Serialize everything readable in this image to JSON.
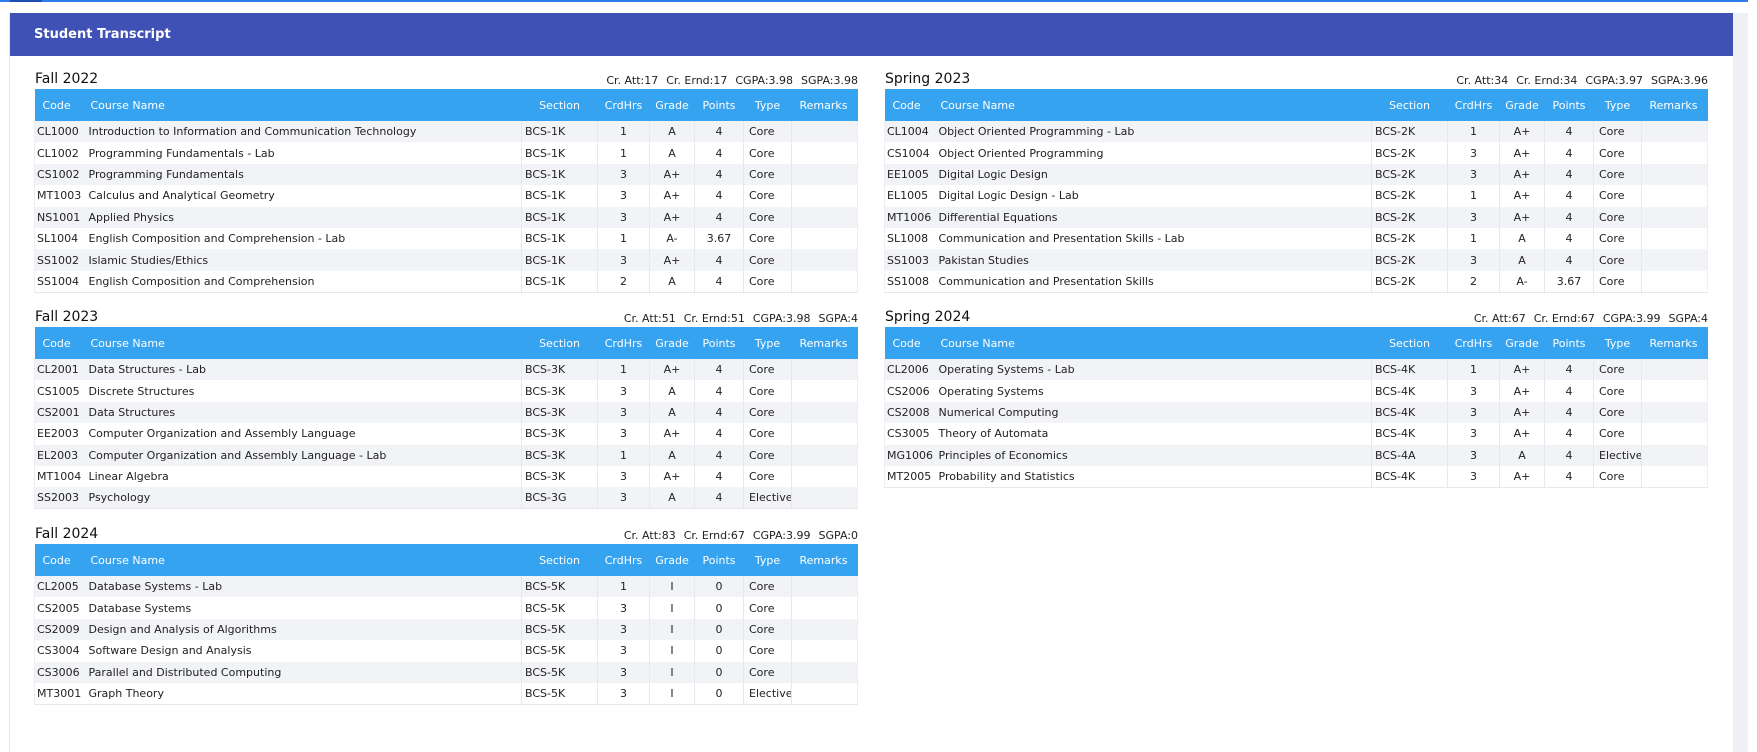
{
  "page": {
    "title": "Student Transcript"
  },
  "columns": [
    "Code",
    "Course Name",
    "Section",
    "CrdHrs",
    "Grade",
    "Points",
    "Type",
    "Remarks"
  ],
  "semesters": [
    {
      "name": "Fall 2022",
      "stats": {
        "cr_att": "Cr. Att:17",
        "cr_ernd": "Cr. Ernd:17",
        "cgpa": "CGPA:3.98",
        "sgpa": "SGPA:3.98"
      },
      "rows": [
        [
          "CL1000",
          "Introduction to Information and Communication Technology",
          "BCS-1K",
          "1",
          "A",
          "4",
          "Core",
          ""
        ],
        [
          "CL1002",
          "Programming Fundamentals - Lab",
          "BCS-1K",
          "1",
          "A",
          "4",
          "Core",
          ""
        ],
        [
          "CS1002",
          "Programming Fundamentals",
          "BCS-1K",
          "3",
          "A+",
          "4",
          "Core",
          ""
        ],
        [
          "MT1003",
          "Calculus and Analytical Geometry",
          "BCS-1K",
          "3",
          "A+",
          "4",
          "Core",
          ""
        ],
        [
          "NS1001",
          "Applied Physics",
          "BCS-1K",
          "3",
          "A+",
          "4",
          "Core",
          ""
        ],
        [
          "SL1004",
          "English Composition and Comprehension - Lab",
          "BCS-1K",
          "1",
          "A-",
          "3.67",
          "Core",
          ""
        ],
        [
          "SS1002",
          "Islamic Studies/Ethics",
          "BCS-1K",
          "3",
          "A+",
          "4",
          "Core",
          ""
        ],
        [
          "SS1004",
          "English Composition and Comprehension",
          "BCS-1K",
          "2",
          "A",
          "4",
          "Core",
          ""
        ]
      ]
    },
    {
      "name": "Spring 2023",
      "stats": {
        "cr_att": "Cr. Att:34",
        "cr_ernd": "Cr. Ernd:34",
        "cgpa": "CGPA:3.97",
        "sgpa": "SGPA:3.96"
      },
      "rows": [
        [
          "CL1004",
          "Object Oriented Programming - Lab",
          "BCS-2K",
          "1",
          "A+",
          "4",
          "Core",
          ""
        ],
        [
          "CS1004",
          "Object Oriented Programming",
          "BCS-2K",
          "3",
          "A+",
          "4",
          "Core",
          ""
        ],
        [
          "EE1005",
          "Digital Logic Design",
          "BCS-2K",
          "3",
          "A+",
          "4",
          "Core",
          ""
        ],
        [
          "EL1005",
          "Digital Logic Design - Lab",
          "BCS-2K",
          "1",
          "A+",
          "4",
          "Core",
          ""
        ],
        [
          "MT1006",
          "Differential Equations",
          "BCS-2K",
          "3",
          "A+",
          "4",
          "Core",
          ""
        ],
        [
          "SL1008",
          "Communication and Presentation Skills - Lab",
          "BCS-2K",
          "1",
          "A",
          "4",
          "Core",
          ""
        ],
        [
          "SS1003",
          "Pakistan Studies",
          "BCS-2K",
          "3",
          "A",
          "4",
          "Core",
          ""
        ],
        [
          "SS1008",
          "Communication and Presentation Skills",
          "BCS-2K",
          "2",
          "A-",
          "3.67",
          "Core",
          ""
        ]
      ]
    },
    {
      "name": "Fall 2023",
      "stats": {
        "cr_att": "Cr. Att:51",
        "cr_ernd": "Cr. Ernd:51",
        "cgpa": "CGPA:3.98",
        "sgpa": "SGPA:4"
      },
      "rows": [
        [
          "CL2001",
          "Data Structures - Lab",
          "BCS-3K",
          "1",
          "A+",
          "4",
          "Core",
          ""
        ],
        [
          "CS1005",
          "Discrete Structures",
          "BCS-3K",
          "3",
          "A",
          "4",
          "Core",
          ""
        ],
        [
          "CS2001",
          "Data Structures",
          "BCS-3K",
          "3",
          "A",
          "4",
          "Core",
          ""
        ],
        [
          "EE2003",
          "Computer Organization and Assembly Language",
          "BCS-3K",
          "3",
          "A+",
          "4",
          "Core",
          ""
        ],
        [
          "EL2003",
          "Computer Organization and Assembly Language - Lab",
          "BCS-3K",
          "1",
          "A",
          "4",
          "Core",
          ""
        ],
        [
          "MT1004",
          "Linear Algebra",
          "BCS-3K",
          "3",
          "A+",
          "4",
          "Core",
          ""
        ],
        [
          "SS2003",
          "Psychology",
          "BCS-3G",
          "3",
          "A",
          "4",
          "Elective",
          ""
        ]
      ]
    },
    {
      "name": "Spring 2024",
      "stats": {
        "cr_att": "Cr. Att:67",
        "cr_ernd": "Cr. Ernd:67",
        "cgpa": "CGPA:3.99",
        "sgpa": "SGPA:4"
      },
      "rows": [
        [
          "CL2006",
          "Operating Systems - Lab",
          "BCS-4K",
          "1",
          "A+",
          "4",
          "Core",
          ""
        ],
        [
          "CS2006",
          "Operating Systems",
          "BCS-4K",
          "3",
          "A+",
          "4",
          "Core",
          ""
        ],
        [
          "CS2008",
          "Numerical Computing",
          "BCS-4K",
          "3",
          "A+",
          "4",
          "Core",
          ""
        ],
        [
          "CS3005",
          "Theory of Automata",
          "BCS-4K",
          "3",
          "A+",
          "4",
          "Core",
          ""
        ],
        [
          "MG1006",
          "Principles of Economics",
          "BCS-4A",
          "3",
          "A",
          "4",
          "Elective",
          ""
        ],
        [
          "MT2005",
          "Probability and Statistics",
          "BCS-4K",
          "3",
          "A+",
          "4",
          "Core",
          ""
        ]
      ]
    },
    {
      "name": "Fall 2024",
      "stats": {
        "cr_att": "Cr. Att:83",
        "cr_ernd": "Cr. Ernd:67",
        "cgpa": "CGPA:3.99",
        "sgpa": "SGPA:0"
      },
      "rows": [
        [
          "CL2005",
          "Database Systems - Lab",
          "BCS-5K",
          "1",
          "I",
          "0",
          "Core",
          ""
        ],
        [
          "CS2005",
          "Database Systems",
          "BCS-5K",
          "3",
          "I",
          "0",
          "Core",
          ""
        ],
        [
          "CS2009",
          "Design and Analysis of Algorithms",
          "BCS-5K",
          "3",
          "I",
          "0",
          "Core",
          ""
        ],
        [
          "CS3004",
          "Software Design and Analysis",
          "BCS-5K",
          "3",
          "I",
          "0",
          "Core",
          ""
        ],
        [
          "CS3006",
          "Parallel and Distributed Computing",
          "BCS-5K",
          "3",
          "I",
          "0",
          "Core",
          ""
        ],
        [
          "MT3001",
          "Graph Theory",
          "BCS-5K",
          "3",
          "I",
          "0",
          "Elective",
          ""
        ]
      ]
    }
  ]
}
